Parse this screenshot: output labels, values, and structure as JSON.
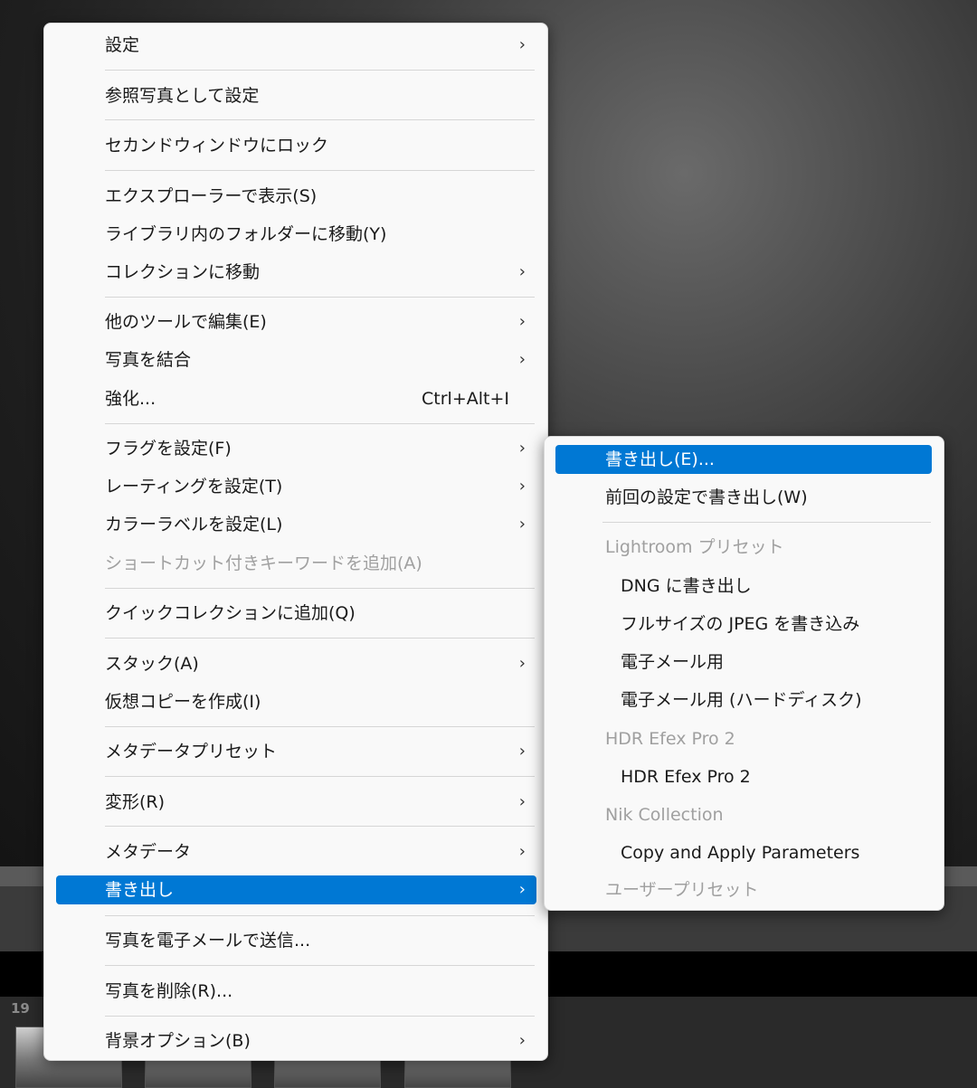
{
  "filmstrip": {
    "index": "19"
  },
  "context_menu": {
    "items": [
      {
        "label": "設定",
        "submenu": true
      },
      {
        "label": "参照写真として設定"
      },
      {
        "label": "セカンドウィンドウにロック"
      },
      {
        "label": "エクスプローラーで表示(S)"
      },
      {
        "label": "ライブラリ内のフォルダーに移動(Y)"
      },
      {
        "label": "コレクションに移動",
        "submenu": true
      },
      {
        "label": "他のツールで編集(E)",
        "submenu": true
      },
      {
        "label": "写真を結合",
        "submenu": true
      },
      {
        "label": "強化...",
        "shortcut": "Ctrl+Alt+I"
      },
      {
        "label": "フラグを設定(F)",
        "submenu": true
      },
      {
        "label": "レーティングを設定(T)",
        "submenu": true
      },
      {
        "label": "カラーラベルを設定(L)",
        "submenu": true
      },
      {
        "label": "ショートカット付きキーワードを追加(A)",
        "disabled": true
      },
      {
        "label": "クイックコレクションに追加(Q)"
      },
      {
        "label": "スタック(A)",
        "submenu": true
      },
      {
        "label": "仮想コピーを作成(I)"
      },
      {
        "label": "メタデータプリセット",
        "submenu": true
      },
      {
        "label": "変形(R)",
        "submenu": true
      },
      {
        "label": "メタデータ",
        "submenu": true
      },
      {
        "label": "書き出し",
        "submenu": true,
        "highlighted": true
      },
      {
        "label": "写真を電子メールで送信..."
      },
      {
        "label": "写真を削除(R)..."
      },
      {
        "label": "背景オプション(B)",
        "submenu": true
      }
    ]
  },
  "export_submenu": {
    "items": [
      {
        "label": "書き出し(E)...",
        "highlighted": true
      },
      {
        "label": "前回の設定で書き出し(W)"
      },
      {
        "label": "Lightroom プリセット",
        "header": true
      },
      {
        "label": "DNG に書き出し"
      },
      {
        "label": "フルサイズの JPEG を書き込み"
      },
      {
        "label": "電子メール用"
      },
      {
        "label": "電子メール用 (ハードディスク)"
      },
      {
        "label": "HDR Efex Pro 2",
        "header": true
      },
      {
        "label": "HDR Efex Pro 2"
      },
      {
        "label": "Nik Collection",
        "header": true
      },
      {
        "label": "Copy and Apply Parameters"
      },
      {
        "label": "ユーザープリセット",
        "header": true
      }
    ]
  },
  "colors": {
    "highlight": "#0078d4",
    "menu_bg": "#f9f9f9",
    "disabled": "#a0a0a0"
  },
  "icons": {
    "submenu_arrow": "chevron-right-icon"
  }
}
